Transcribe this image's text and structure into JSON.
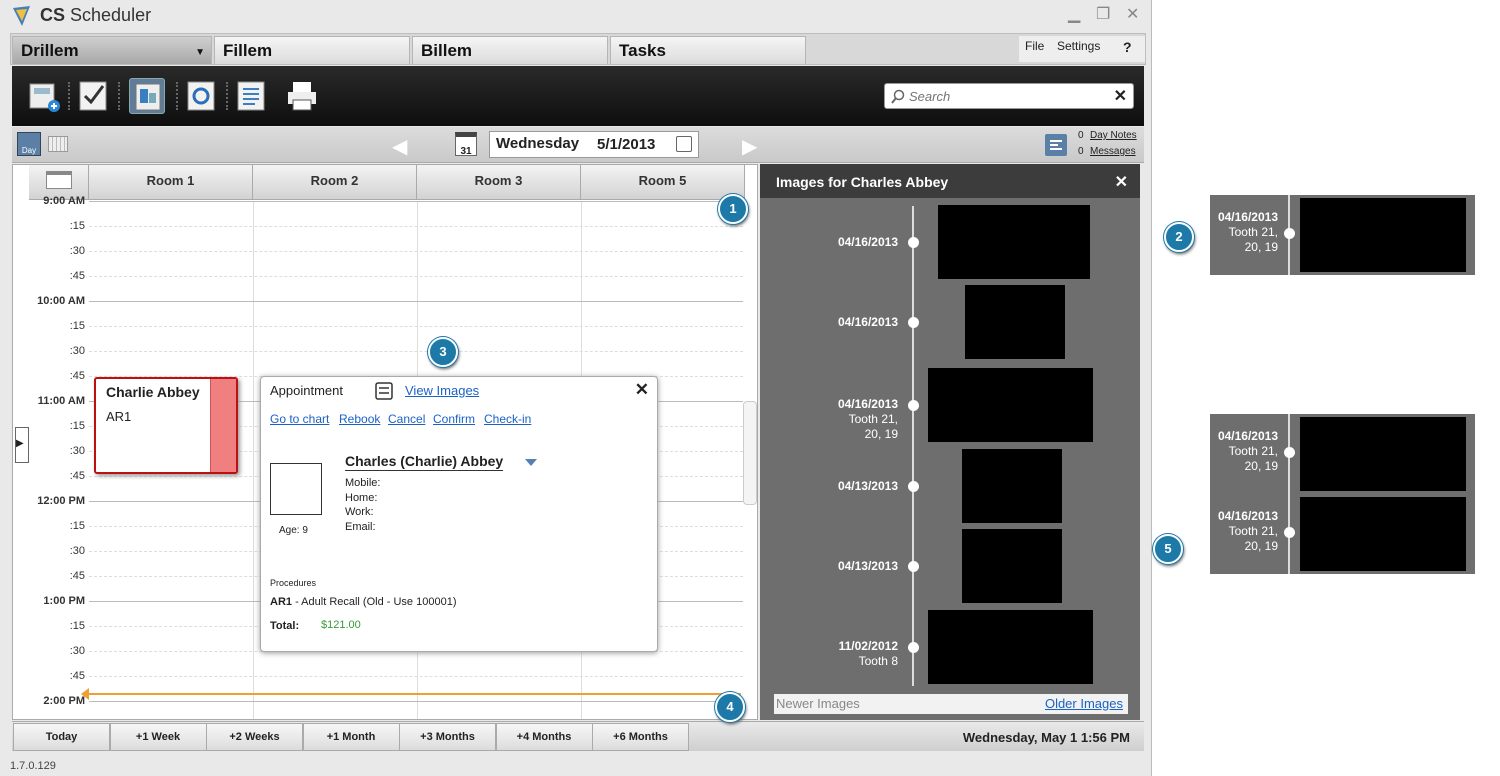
{
  "app": {
    "title_bold": "CS",
    "title_rest": " Scheduler",
    "version": "1.7.0.129"
  },
  "tabs": [
    {
      "label": "Drillem"
    },
    {
      "label": "Fillem"
    },
    {
      "label": "Billem"
    },
    {
      "label": "Tasks"
    }
  ],
  "menu": {
    "file": "File",
    "settings": "Settings",
    "help": "?"
  },
  "search": {
    "placeholder": "Search"
  },
  "nav": {
    "day_label": "Day",
    "weekday": "Wednesday",
    "date": "5/1/2013",
    "calendar_day": "31",
    "day_notes_count": "0",
    "day_notes": "Day Notes",
    "messages_count": "0",
    "messages": "Messages"
  },
  "rooms": [
    "Room 1",
    "Room 2",
    "Room 3",
    "Room 5"
  ],
  "times": [
    "9:00 AM",
    ":15",
    ":30",
    ":45",
    "10:00 AM",
    ":15",
    ":30",
    ":45",
    "11:00 AM",
    ":15",
    ":30",
    ":45",
    "12:00 PM",
    ":15",
    ":30",
    ":45",
    "1:00 PM",
    ":15",
    ":30",
    ":45",
    "2:00 PM"
  ],
  "appointment": {
    "name": "Charlie Abbey",
    "code": "AR1"
  },
  "popup": {
    "heading": "Appointment",
    "view_images": "View Images",
    "actions": [
      "Go to chart",
      "Rebook",
      "Cancel",
      "Confirm",
      "Check-in"
    ],
    "patient": "Charles (Charlie) Abbey",
    "mobile": "Mobile:",
    "home": "Home:",
    "work": "Work:",
    "email": "Email:",
    "age": "Age: 9",
    "procedures_label": "Procedures",
    "proc_code": "AR1",
    "proc_desc": " - Adult Recall (Old - Use 100001)",
    "total_label": "Total:",
    "total_value": "$121.00"
  },
  "images_panel": {
    "title": "Images for Charles Abbey",
    "newer": "Newer Images",
    "older": "Older Images",
    "entries": [
      {
        "date": "04/16/2013",
        "tooth": ""
      },
      {
        "date": "04/16/2013",
        "tooth": ""
      },
      {
        "date": "04/16/2013",
        "tooth": "Tooth 21,",
        "tooth2": "20, 19"
      },
      {
        "date": "04/13/2013",
        "tooth": ""
      },
      {
        "date": "04/13/2013",
        "tooth": ""
      },
      {
        "date": "11/02/2012",
        "tooth": "Tooth 8"
      }
    ]
  },
  "side_detail": [
    {
      "date": "04/16/2013",
      "tooth": "Tooth 21,",
      "tooth2": "20, 19"
    },
    {
      "date": "04/16/2013",
      "tooth": "Tooth 21,",
      "tooth2": "20, 19"
    },
    {
      "date": "04/16/2013",
      "tooth": "Tooth 21,",
      "tooth2": "20, 19"
    }
  ],
  "callouts": [
    "1",
    "2",
    "3",
    "4",
    "5"
  ],
  "bottom": {
    "buttons": [
      "Today",
      "+1 Week",
      "+2 Weeks",
      "+1 Month",
      "+3 Months",
      "+4 Months",
      "+6 Months"
    ],
    "status": "Wednesday, May 1  1:56 PM"
  },
  "colors": {
    "accent": "#1d7aa8",
    "appt_border": "#bb1111",
    "now_line": "#f0a030",
    "link": "#1a62c6",
    "total": "#3a9a3a"
  }
}
